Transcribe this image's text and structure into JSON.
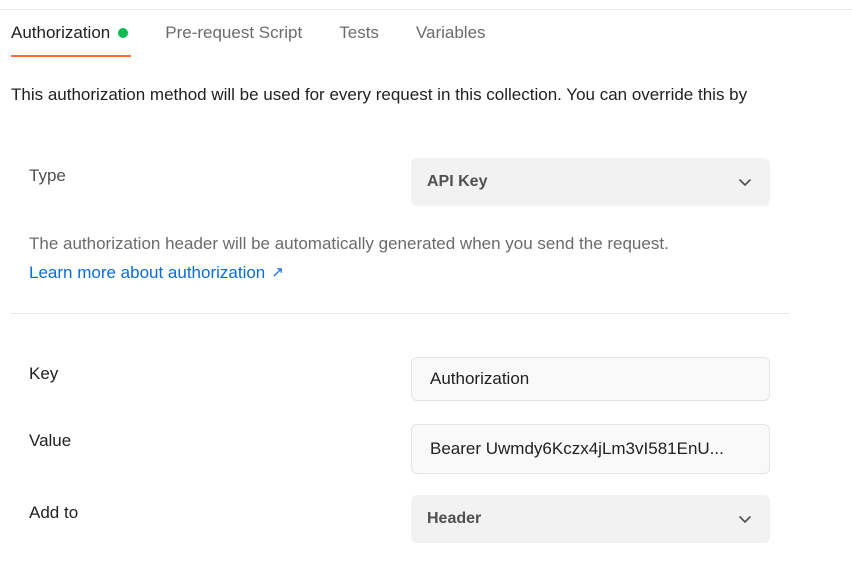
{
  "tabs": [
    {
      "label": "Authorization",
      "active": true,
      "status_dot_color": "#0cbb52"
    },
    {
      "label": "Pre-request Script",
      "active": false
    },
    {
      "label": "Tests",
      "active": false
    },
    {
      "label": "Variables",
      "active": false
    }
  ],
  "intro_text": "This authorization method will be used for every request in this collection. You can override this by",
  "type": {
    "label": "Type",
    "value": "API Key"
  },
  "help": {
    "text": "The authorization header will be automatically generated when you send the request.",
    "link_label": "Learn more about authorization",
    "link_icon": "↗"
  },
  "fields": {
    "key": {
      "label": "Key",
      "value": "Authorization"
    },
    "value": {
      "label": "Value",
      "value": "Bearer Uwmdy6Kczx4jLm3vI581EnU..."
    },
    "add_to": {
      "label": "Add to",
      "value": "Header"
    }
  },
  "colors": {
    "accent": "#ff6c37",
    "link": "#0b6dd4",
    "success": "#0cbb52"
  }
}
